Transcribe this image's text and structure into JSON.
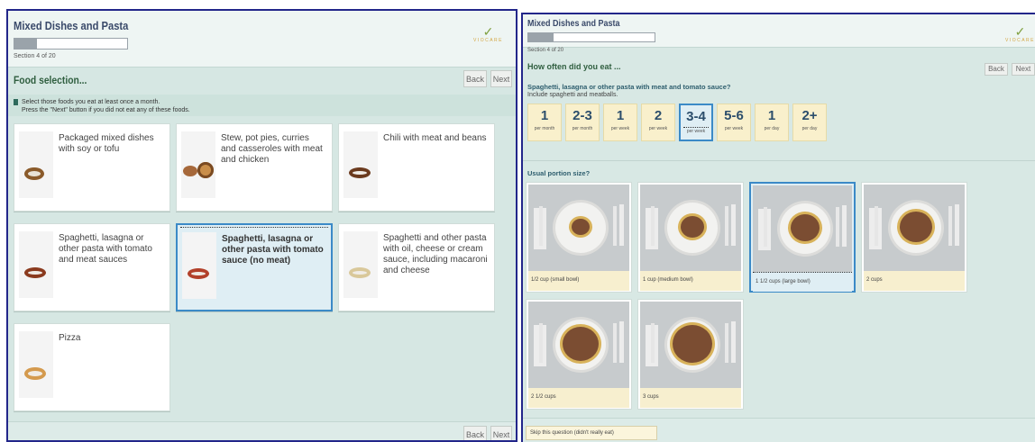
{
  "left": {
    "title": "Mixed Dishes and Pasta",
    "progress": 0.2,
    "section": "Section 4 of 20",
    "logo": {
      "mark": "✓",
      "word": "VIOCARE"
    },
    "heading": "Food selection...",
    "back": "Back",
    "next": "Next",
    "instructions": {
      "line1": "Select those foods you eat at least once a month.",
      "line2": "Press the \"Next\" button if you did not eat any of these foods."
    },
    "foods": [
      {
        "label": "Packaged mixed dishes with soy or tofu",
        "selected": false
      },
      {
        "label": "Stew, pot pies, curries and casseroles with meat and chicken",
        "selected": false
      },
      {
        "label": "Chili with meat and beans",
        "selected": false
      },
      {
        "label": "Spaghetti, lasagna or other pasta with tomato and meat sauces",
        "selected": false
      },
      {
        "label": "Spaghetti, lasagna or other pasta with tomato sauce (no meat)",
        "selected": true
      },
      {
        "label": "Spaghetti and other pasta with oil, cheese or cream sauce, including macaroni and cheese",
        "selected": false
      },
      {
        "label": "Pizza",
        "selected": false
      }
    ],
    "footer_back": "Back",
    "footer_next": "Next"
  },
  "right": {
    "title": "Mixed Dishes and Pasta",
    "progress": 0.2,
    "section": "Section 4 of 20",
    "logo": {
      "mark": "✓",
      "word": "VIOCARE"
    },
    "heading": "How often did you eat ...",
    "back": "Back",
    "next": "Next",
    "question": "Spaghetti, lasagna or other pasta with meat and tomato sauce?",
    "subtext": "Include spaghetti and meatballs.",
    "frequency": [
      {
        "num": "1",
        "unit": "per month",
        "selected": false
      },
      {
        "num": "2-3",
        "unit": "per month",
        "selected": false
      },
      {
        "num": "1",
        "unit": "per week",
        "selected": false
      },
      {
        "num": "2",
        "unit": "per week",
        "selected": false
      },
      {
        "num": "3-4",
        "unit": "per week",
        "selected": true
      },
      {
        "num": "5-6",
        "unit": "per week",
        "selected": false
      },
      {
        "num": "1",
        "unit": "per day",
        "selected": false
      },
      {
        "num": "2+",
        "unit": "per day",
        "selected": false
      }
    ],
    "portion_question": "Usual portion size?",
    "portions": [
      {
        "label": "1/2 cup (small bowl)",
        "selected": false
      },
      {
        "label": "1 cup (medium bowl)",
        "selected": false
      },
      {
        "label": "1 1/2 cups (large bowl)",
        "selected": true
      },
      {
        "label": "2 cups",
        "selected": false
      },
      {
        "label": "2 1/2 cups",
        "selected": false
      },
      {
        "label": "3 cups",
        "selected": false
      }
    ],
    "skip": "Skip this question (didn't really eat)"
  }
}
